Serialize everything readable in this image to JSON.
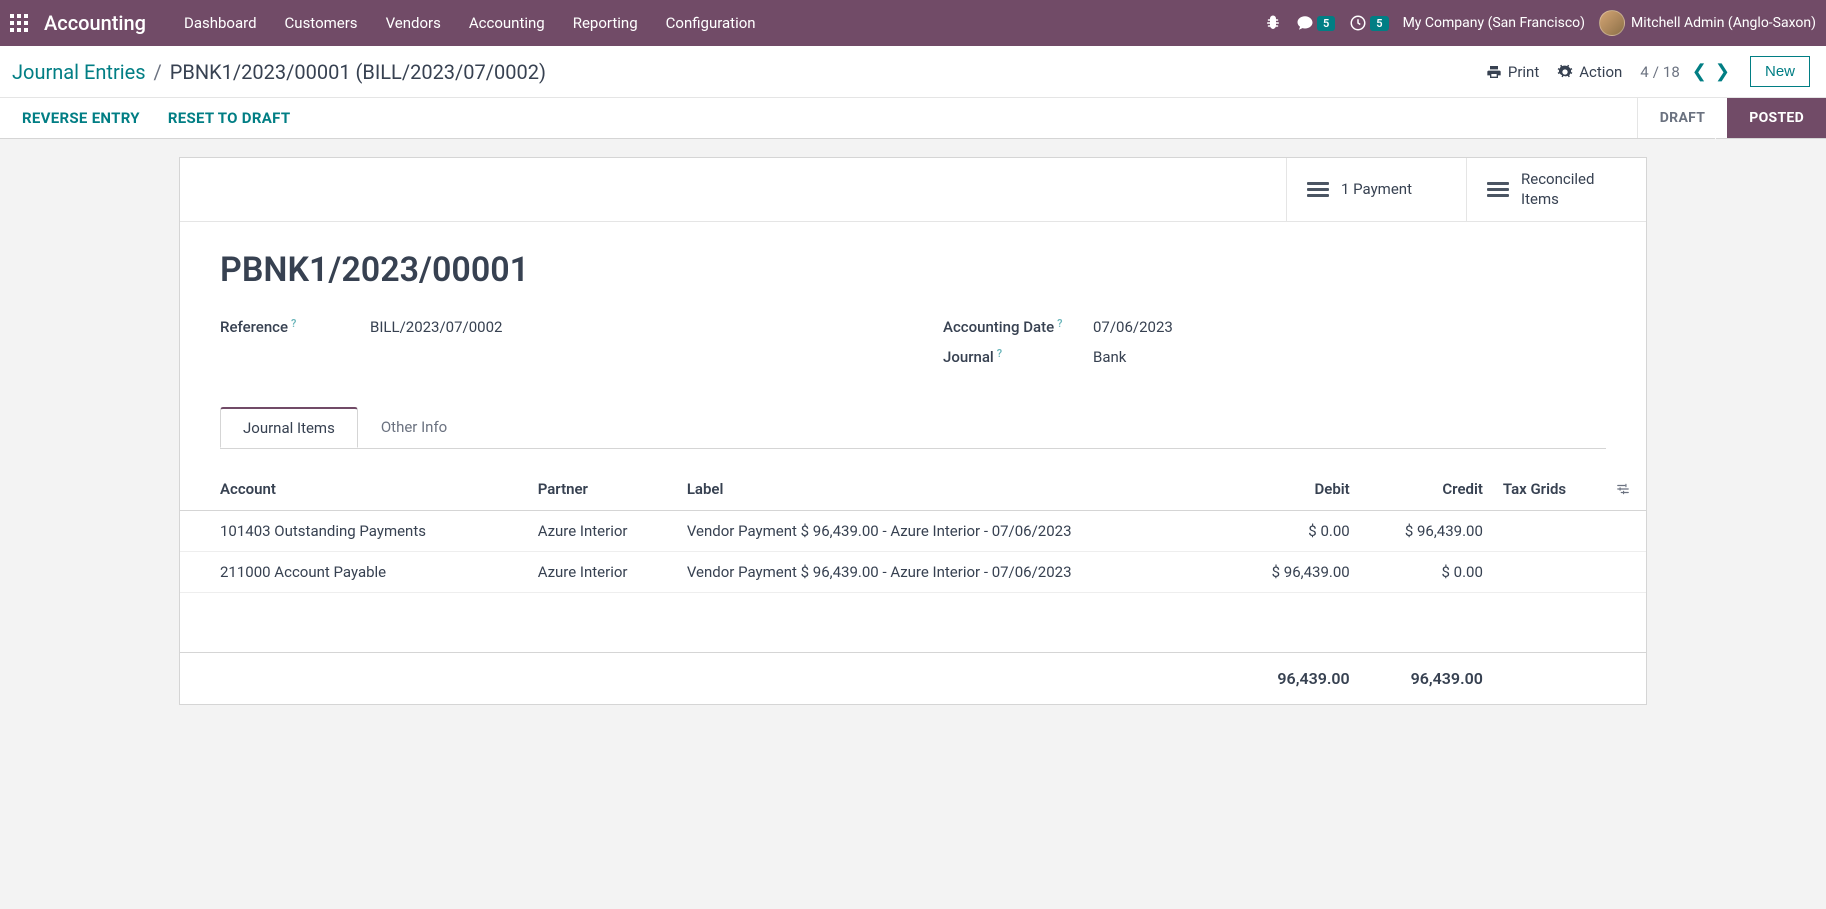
{
  "topbar": {
    "app_name": "Accounting",
    "nav": [
      "Dashboard",
      "Customers",
      "Vendors",
      "Accounting",
      "Reporting",
      "Configuration"
    ],
    "messages_badge": "5",
    "activities_badge": "5",
    "company": "My Company (San Francisco)",
    "user": "Mitchell Admin (Anglo-Saxon)"
  },
  "breadcrumb": {
    "parent": "Journal Entries",
    "current": "PBNK1/2023/00001 (BILL/2023/07/0002)"
  },
  "controlbar": {
    "print": "Print",
    "action": "Action",
    "pager_pos": "4",
    "pager_total": "18",
    "new_btn": "New"
  },
  "statusbar": {
    "reverse": "REVERSE ENTRY",
    "reset": "RESET TO DRAFT",
    "draft": "DRAFT",
    "posted": "POSTED"
  },
  "stat_buttons": {
    "payment": "1 Payment",
    "reconciled_l1": "Reconciled",
    "reconciled_l2": "Items"
  },
  "entry": {
    "name": "PBNK1/2023/00001",
    "reference_label": "Reference",
    "reference_value": "BILL/2023/07/0002",
    "date_label": "Accounting Date",
    "date_value": "07/06/2023",
    "journal_label": "Journal",
    "journal_value": "Bank"
  },
  "tabs": {
    "items": "Journal Items",
    "other": "Other Info"
  },
  "table": {
    "headers": {
      "account": "Account",
      "partner": "Partner",
      "label": "Label",
      "debit": "Debit",
      "credit": "Credit",
      "tax": "Tax Grids"
    },
    "rows": [
      {
        "account": "101403 Outstanding Payments",
        "partner": "Azure Interior",
        "label": "Vendor Payment $ 96,439.00 - Azure Interior - 07/06/2023",
        "debit": "$ 0.00",
        "credit": "$ 96,439.00"
      },
      {
        "account": "211000 Account Payable",
        "partner": "Azure Interior",
        "label": "Vendor Payment $ 96,439.00 - Azure Interior - 07/06/2023",
        "debit": "$ 96,439.00",
        "credit": "$ 0.00"
      }
    ],
    "totals": {
      "debit": "96,439.00",
      "credit": "96,439.00"
    }
  }
}
